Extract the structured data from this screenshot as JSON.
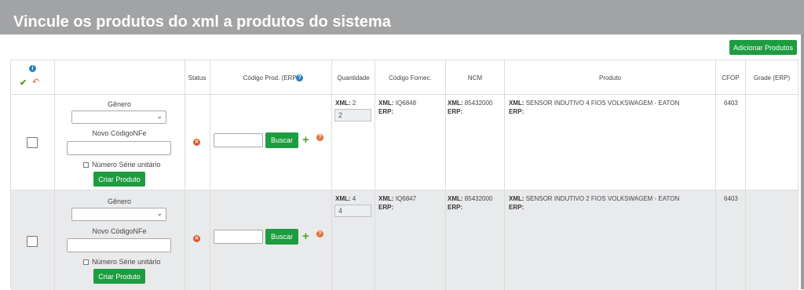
{
  "modal": {
    "title": "Vincule os produtos do xml a produtos do sistema"
  },
  "toolbar": {
    "add_products_label": "Adicionar Produtos"
  },
  "table": {
    "headers": {
      "info_icon": "info-icon",
      "status": "Status",
      "codigo_prod_erp": "Código Prod. (ERP)",
      "quantidade": "Quantidade",
      "codigo_fornec": "Código Fornec.",
      "ncm": "NCM",
      "produto": "Produto",
      "cfop": "CFOP",
      "grade_erp": "Grade (ERP)"
    },
    "rows": [
      {
        "genero_label": "Gênero",
        "genero_value": "",
        "novo_codigo_label": "Novo CódigoNFe",
        "novo_codigo_value": "",
        "numero_serie_label": "Número Série unitário",
        "criar_produto_label": "Criar Produto",
        "codigo_erp_value": "",
        "buscar_label": "Buscar",
        "xml_label": "XML:",
        "erp_label": "ERP:",
        "qty_xml": "2",
        "qty_input": "2",
        "codigo_fornec_xml": "IQ6848",
        "ncm_xml": "85432000",
        "produto_xml": "SENSOR INDUTIVO 4 FIOS VOLKSWAGEM - EATON",
        "cfop": "6403"
      },
      {
        "genero_label": "Gênero",
        "genero_value": "",
        "novo_codigo_label": "Novo CódigoNFe",
        "novo_codigo_value": "",
        "numero_serie_label": "Número Série unitário",
        "criar_produto_label": "Criar Produto",
        "codigo_erp_value": "",
        "buscar_label": "Buscar",
        "xml_label": "XML:",
        "erp_label": "ERP:",
        "qty_xml": "4",
        "qty_input": "4",
        "codigo_fornec_xml": "IQ6847",
        "ncm_xml": "85432000",
        "produto_xml": "SENSOR INDUTIVO 2 FIOS VOLKSWAGEM - EATON",
        "cfop": "6403"
      }
    ]
  },
  "colors": {
    "header_bg": "#a2a3a5",
    "accent_green": "#1e9c40",
    "row_alt_bg": "#e9eaec",
    "info_blue": "#2a7fc9",
    "error_orange": "#d9562b"
  }
}
